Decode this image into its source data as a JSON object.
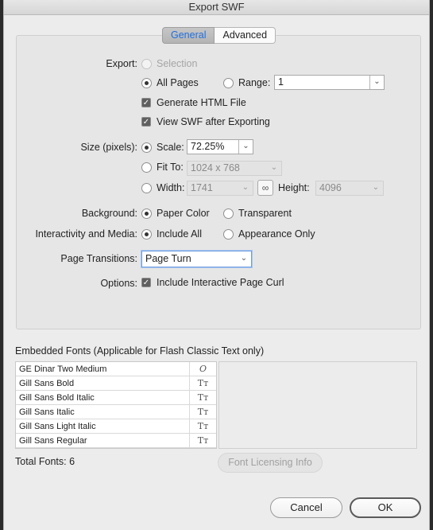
{
  "window": {
    "title": "Export SWF"
  },
  "tabs": {
    "general": "General",
    "advanced": "Advanced"
  },
  "export": {
    "label": "Export:",
    "selection": "Selection",
    "all_pages": "All Pages",
    "range_label": "Range:",
    "range_value": "1",
    "generate_html": "Generate HTML File",
    "view_swf": "View SWF after Exporting"
  },
  "size": {
    "label": "Size (pixels):",
    "scale_label": "Scale:",
    "scale_value": "72.25%",
    "fit_to_label": "Fit To:",
    "fit_to_value": "1024 x 768",
    "width_label": "Width:",
    "width_value": "1741",
    "height_label": "Height:",
    "height_value": "4096"
  },
  "background": {
    "label": "Background:",
    "paper_color": "Paper Color",
    "transparent": "Transparent"
  },
  "interactivity": {
    "label": "Interactivity and Media:",
    "include_all": "Include All",
    "appearance_only": "Appearance Only"
  },
  "page_transitions": {
    "label": "Page Transitions:",
    "value": "Page Turn"
  },
  "options": {
    "label": "Options:",
    "page_curl": "Include Interactive Page Curl"
  },
  "embedded_fonts": {
    "title": "Embedded Fonts (Applicable for Flash Classic Text only)",
    "fonts": [
      {
        "name": "GE Dinar Two Medium",
        "icon": "opentype-icon"
      },
      {
        "name": "Gill Sans Bold",
        "icon": "truetype-icon"
      },
      {
        "name": "Gill Sans Bold Italic",
        "icon": "truetype-icon"
      },
      {
        "name": "Gill Sans Italic",
        "icon": "truetype-icon"
      },
      {
        "name": "Gill Sans Light Italic",
        "icon": "truetype-icon"
      },
      {
        "name": "Gill Sans Regular",
        "icon": "truetype-icon"
      }
    ],
    "total_label": "Total Fonts: 6",
    "licensing_button": "Font Licensing Info"
  },
  "footer": {
    "cancel": "Cancel",
    "ok": "OK"
  }
}
